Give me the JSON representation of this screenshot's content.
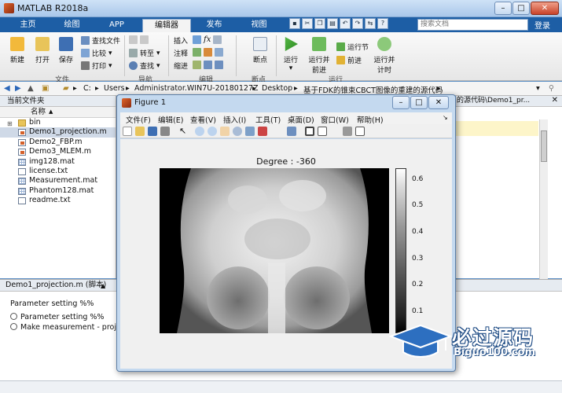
{
  "window": {
    "title": "MATLAB R2018a"
  },
  "tabs": [
    {
      "label": "主页"
    },
    {
      "label": "绘图"
    },
    {
      "label": "APP"
    },
    {
      "label": "编辑器"
    },
    {
      "label": "发布"
    },
    {
      "label": "视图"
    }
  ],
  "search": {
    "placeholder": "搜索文档"
  },
  "login_label": "登录",
  "ribbon": {
    "new": "新建",
    "open": "打开",
    "save": "保存",
    "find_files": "查找文件",
    "compare": "比较",
    "print": "打印",
    "goto": "转至",
    "find": "查找",
    "insert": "插入",
    "comment": "注释",
    "indent": "缩进",
    "breakpoint": "断点",
    "run": "运行",
    "run_advance": [
      "运行并",
      "前进"
    ],
    "run_section": "运行节",
    "advance": "前进",
    "run_time": [
      "运行并",
      "计时"
    ],
    "fx": "fx",
    "groups": {
      "file": "文件",
      "navigate": "导航",
      "edit": "编辑",
      "breakpoints": "断点",
      "run": "运行"
    }
  },
  "address": {
    "parts": [
      "C:",
      "Users",
      "Administrator.WIN7U-20180127Z",
      "Desktop",
      "基于FDK的锥束CBCT图像的重建的源代码"
    ]
  },
  "current_folder": {
    "title": "当前文件夹",
    "col_name": "名称",
    "sort_indicator": "▲",
    "files": [
      {
        "name": "bin",
        "type": "folder"
      },
      {
        "name": "Demo1_projection.m",
        "type": "m"
      },
      {
        "name": "Demo2_FBP.m",
        "type": "m"
      },
      {
        "name": "Demo3_MLEM.m",
        "type": "m"
      },
      {
        "name": "img128.mat",
        "type": "mat"
      },
      {
        "name": "license.txt",
        "type": "txt"
      },
      {
        "name": "Measurement.mat",
        "type": "mat"
      },
      {
        "name": "Phantom128.mat",
        "type": "mat"
      },
      {
        "name": "readme.txt",
        "type": "txt"
      }
    ]
  },
  "editor_tab": {
    "path": "的源代码\\Demo1_pr..."
  },
  "details": {
    "title": "Demo1_projection.m  (脚本)",
    "header_line": "Parameter setting %%",
    "items": [
      "Parameter setting %%",
      "Make measurement - proje"
    ]
  },
  "figure": {
    "title": "Figure 1",
    "menus": [
      "文件(F)",
      "编辑(E)",
      "查看(V)",
      "插入(I)",
      "工具(T)",
      "桌面(D)",
      "窗口(W)",
      "帮助(H)"
    ],
    "plot_title": "Degree : -360",
    "colorbar_ticks": [
      "0.6",
      "0.5",
      "0.4",
      "0.3",
      "0.2",
      "0.1"
    ]
  },
  "watermark": {
    "cn": "必过源码",
    "en": "Biguo100.com"
  }
}
